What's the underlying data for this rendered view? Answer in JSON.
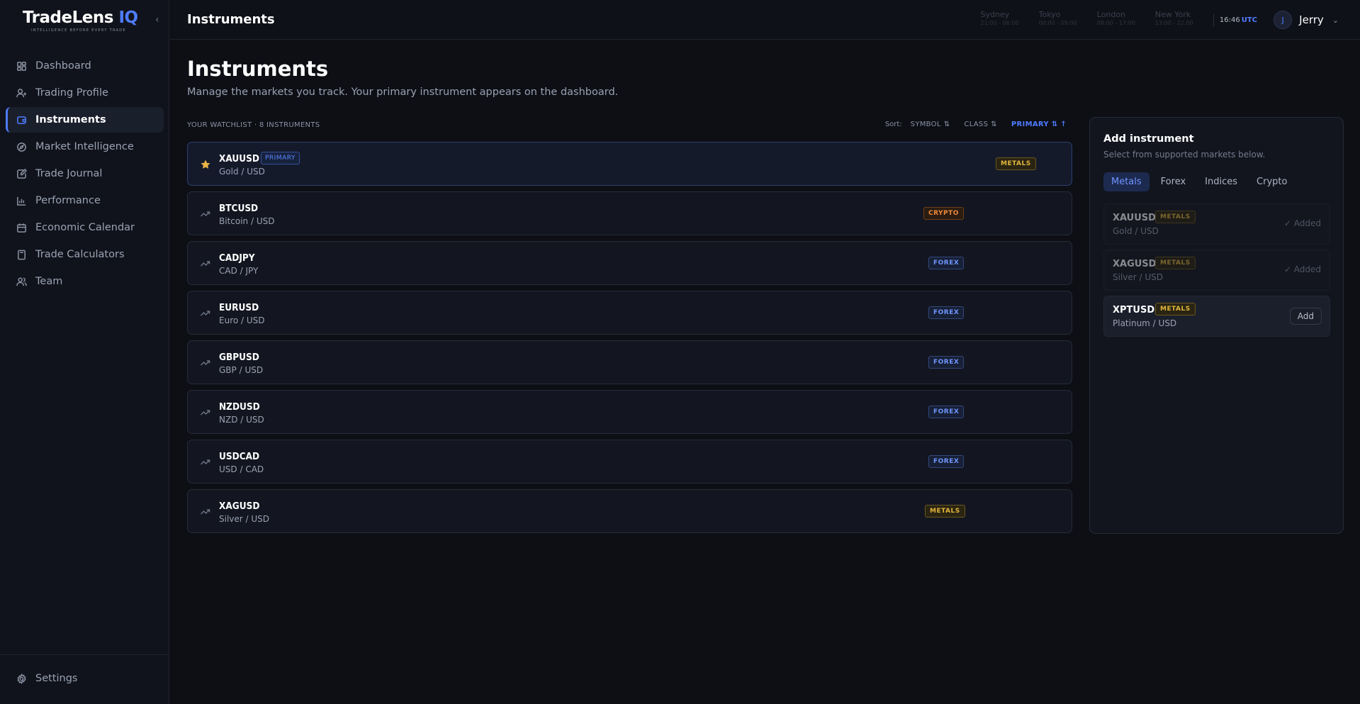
{
  "brand": {
    "name_main": "TradeLens",
    "name_accent": "IQ",
    "tagline": "INTELLIGENCE BEFORE EVERY TRADE"
  },
  "nav": [
    {
      "label": "Dashboard",
      "icon": "dashboard-icon"
    },
    {
      "label": "Trading Profile",
      "icon": "user-profile-icon"
    },
    {
      "label": "Instruments",
      "icon": "wallet-icon",
      "active": true
    },
    {
      "label": "Market Intelligence",
      "icon": "compass-icon"
    },
    {
      "label": "Trade Journal",
      "icon": "journal-icon"
    },
    {
      "label": "Performance",
      "icon": "bar-chart-icon"
    },
    {
      "label": "Economic Calendar",
      "icon": "calendar-icon"
    },
    {
      "label": "Trade Calculators",
      "icon": "calculator-icon"
    },
    {
      "label": "Team",
      "icon": "team-icon"
    }
  ],
  "settings_label": "Settings",
  "topbar": {
    "title": "Instruments",
    "sessions": [
      {
        "name": "Sydney",
        "time": "21:00 - 06:00"
      },
      {
        "name": "Tokyo",
        "time": "00:00 - 09:00"
      },
      {
        "name": "London",
        "time": "08:00 - 17:00"
      },
      {
        "name": "New York",
        "time": "13:00 - 22:00"
      }
    ],
    "utc_time": "16:46",
    "utc_label": "UTC",
    "user_initial": "J",
    "user_name": "Jerry"
  },
  "page": {
    "title": "Instruments",
    "subtitle": "Manage the markets you track. Your primary instrument appears on the dashboard."
  },
  "watchlist": {
    "heading": "YOUR WATCHLIST · 8 INSTRUMENTS",
    "sort_label": "Sort:",
    "sort_symbol": "SYMBOL",
    "sort_class": "CLASS",
    "sort_primary": "PRIMARY",
    "primary_badge": "PRIMARY",
    "items": [
      {
        "symbol": "XAUUSD",
        "name": "Gold / USD",
        "class": "METALS",
        "primary": true
      },
      {
        "symbol": "BTCUSD",
        "name": "Bitcoin / USD",
        "class": "CRYPTO"
      },
      {
        "symbol": "CADJPY",
        "name": "CAD / JPY",
        "class": "FOREX"
      },
      {
        "symbol": "EURUSD",
        "name": "Euro / USD",
        "class": "FOREX"
      },
      {
        "symbol": "GBPUSD",
        "name": "GBP / USD",
        "class": "FOREX"
      },
      {
        "symbol": "NZDUSD",
        "name": "NZD / USD",
        "class": "FOREX"
      },
      {
        "symbol": "USDCAD",
        "name": "USD / CAD",
        "class": "FOREX"
      },
      {
        "symbol": "XAGUSD",
        "name": "Silver / USD",
        "class": "METALS"
      }
    ]
  },
  "add_panel": {
    "title": "Add instrument",
    "subtitle": "Select from supported markets below.",
    "tabs": [
      "Metals",
      "Forex",
      "Indices",
      "Crypto"
    ],
    "active_tab": "Metals",
    "added_label": "✓ Added",
    "add_label": "Add",
    "items": [
      {
        "symbol": "XAUUSD",
        "name": "Gold / USD",
        "class": "METALS",
        "added": true
      },
      {
        "symbol": "XAGUSD",
        "name": "Silver / USD",
        "class": "METALS",
        "added": true
      },
      {
        "symbol": "XPTUSD",
        "name": "Platinum / USD",
        "class": "METALS",
        "added": false
      }
    ]
  },
  "colors": {
    "accent": "#4f7cff",
    "metals": "#e2b53d",
    "crypto": "#ef8a3a",
    "forex": "#6f95ff"
  }
}
